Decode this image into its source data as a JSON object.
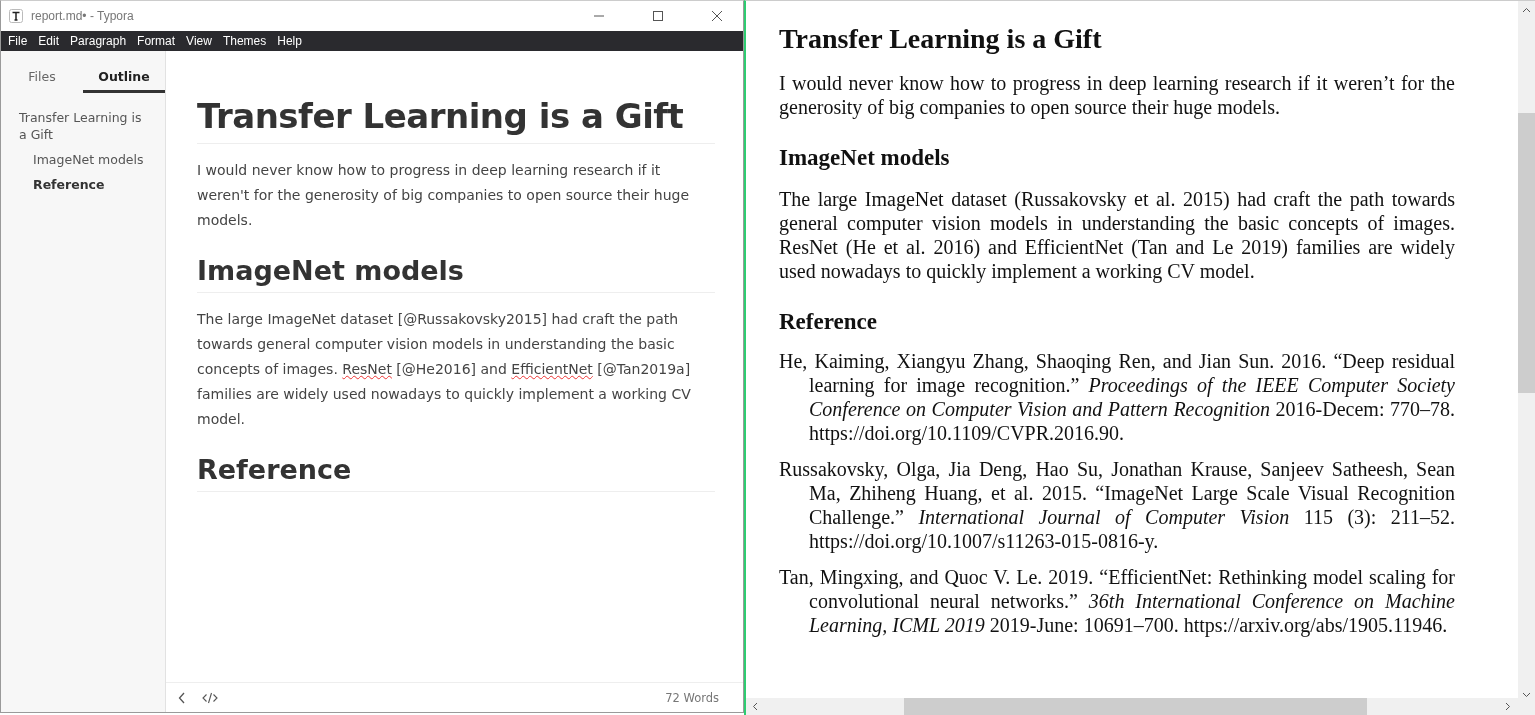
{
  "window": {
    "title": "report.md• - Typora"
  },
  "menu": [
    "File",
    "Edit",
    "Paragraph",
    "Format",
    "View",
    "Themes",
    "Help"
  ],
  "sidebar": {
    "tabs": [
      {
        "label": "Files",
        "selected": false
      },
      {
        "label": "Outline",
        "selected": true
      }
    ],
    "outline": [
      {
        "label": "Transfer Learning is a Gift",
        "selected": false,
        "children": [
          {
            "label": "ImageNet models",
            "selected": false
          },
          {
            "label": "Reference",
            "selected": true
          }
        ]
      }
    ]
  },
  "editor": {
    "blocks": [
      {
        "kind": "h1",
        "segments": [
          {
            "text": "Transfer Learning is a Gift",
            "misspelled": false
          }
        ]
      },
      {
        "kind": "p",
        "segments": [
          {
            "text": "I would never know how to progress in deep learning research if it weren't for the generosity of big companies to open source their huge models.",
            "misspelled": false
          }
        ]
      },
      {
        "kind": "h2",
        "segments": [
          {
            "text": "ImageNet models",
            "misspelled": false
          }
        ]
      },
      {
        "kind": "p",
        "segments": [
          {
            "text": "The large ImageNet dataset [@Russakovsky2015] had craft the path towards general computer vision models in understanding the basic concepts of images. ",
            "misspelled": false
          },
          {
            "text": "ResNet",
            "misspelled": true
          },
          {
            "text": " [@He2016] and ",
            "misspelled": false
          },
          {
            "text": "EfficientNet",
            "misspelled": true
          },
          {
            "text": " [@Tan2019a] families are widely used nowadays to quickly implement a working CV model.",
            "misspelled": false
          }
        ]
      },
      {
        "kind": "h2",
        "segments": [
          {
            "text": "Reference",
            "misspelled": false
          }
        ]
      }
    ]
  },
  "status_bar": {
    "word_count": "72 Words"
  },
  "preview": {
    "title": "Transfer Learning is a Gift",
    "intro": "I would never know how to progress in deep learning research if it weren’t for the generosity of big companies to open source their huge models.",
    "sections": [
      {
        "heading": "ImageNet models",
        "body": "The large ImageNet dataset (Russakovsky et al. 2015) had craft the path towards general computer vision models in understanding the basic concepts of images. ResNet (He et al. 2016) and EfficientNet (Tan and Le 2019) families are widely used nowadays to quickly implement a working CV model."
      }
    ],
    "reference_heading": "Reference",
    "references": [
      "He, Kaiming, Xiangyu Zhang, Shaoqing Ren, and Jian Sun.  2016.  “Deep residual learning for image recognition.” *Proceedings of the IEEE Computer Society Conference on Computer Vision and Pattern Recognition* 2016-Decem: 770–78. https://doi.org/10.1109/CVPR.2016.90.",
      "Russakovsky, Olga, Jia Deng, Hao Su, Jonathan Krause, Sanjeev Satheesh, Sean Ma, Zhiheng Huang, et al.  2015.  “ImageNet Large Scale Visual Recognition Challenge.” *International Journal of Computer Vision* 115 (3): 211–52. https://doi.org/10.1007/s11263-015-0816-y.",
      "Tan, Mingxing, and Quoc V. Le. 2019. “EfficientNet: Rethinking model scaling for convolutional neural networks.” *36th International Conference on Machine Learning, ICML 2019* 2019-June: 10691–700. https://arxiv.org/abs/1905.11946."
    ]
  }
}
